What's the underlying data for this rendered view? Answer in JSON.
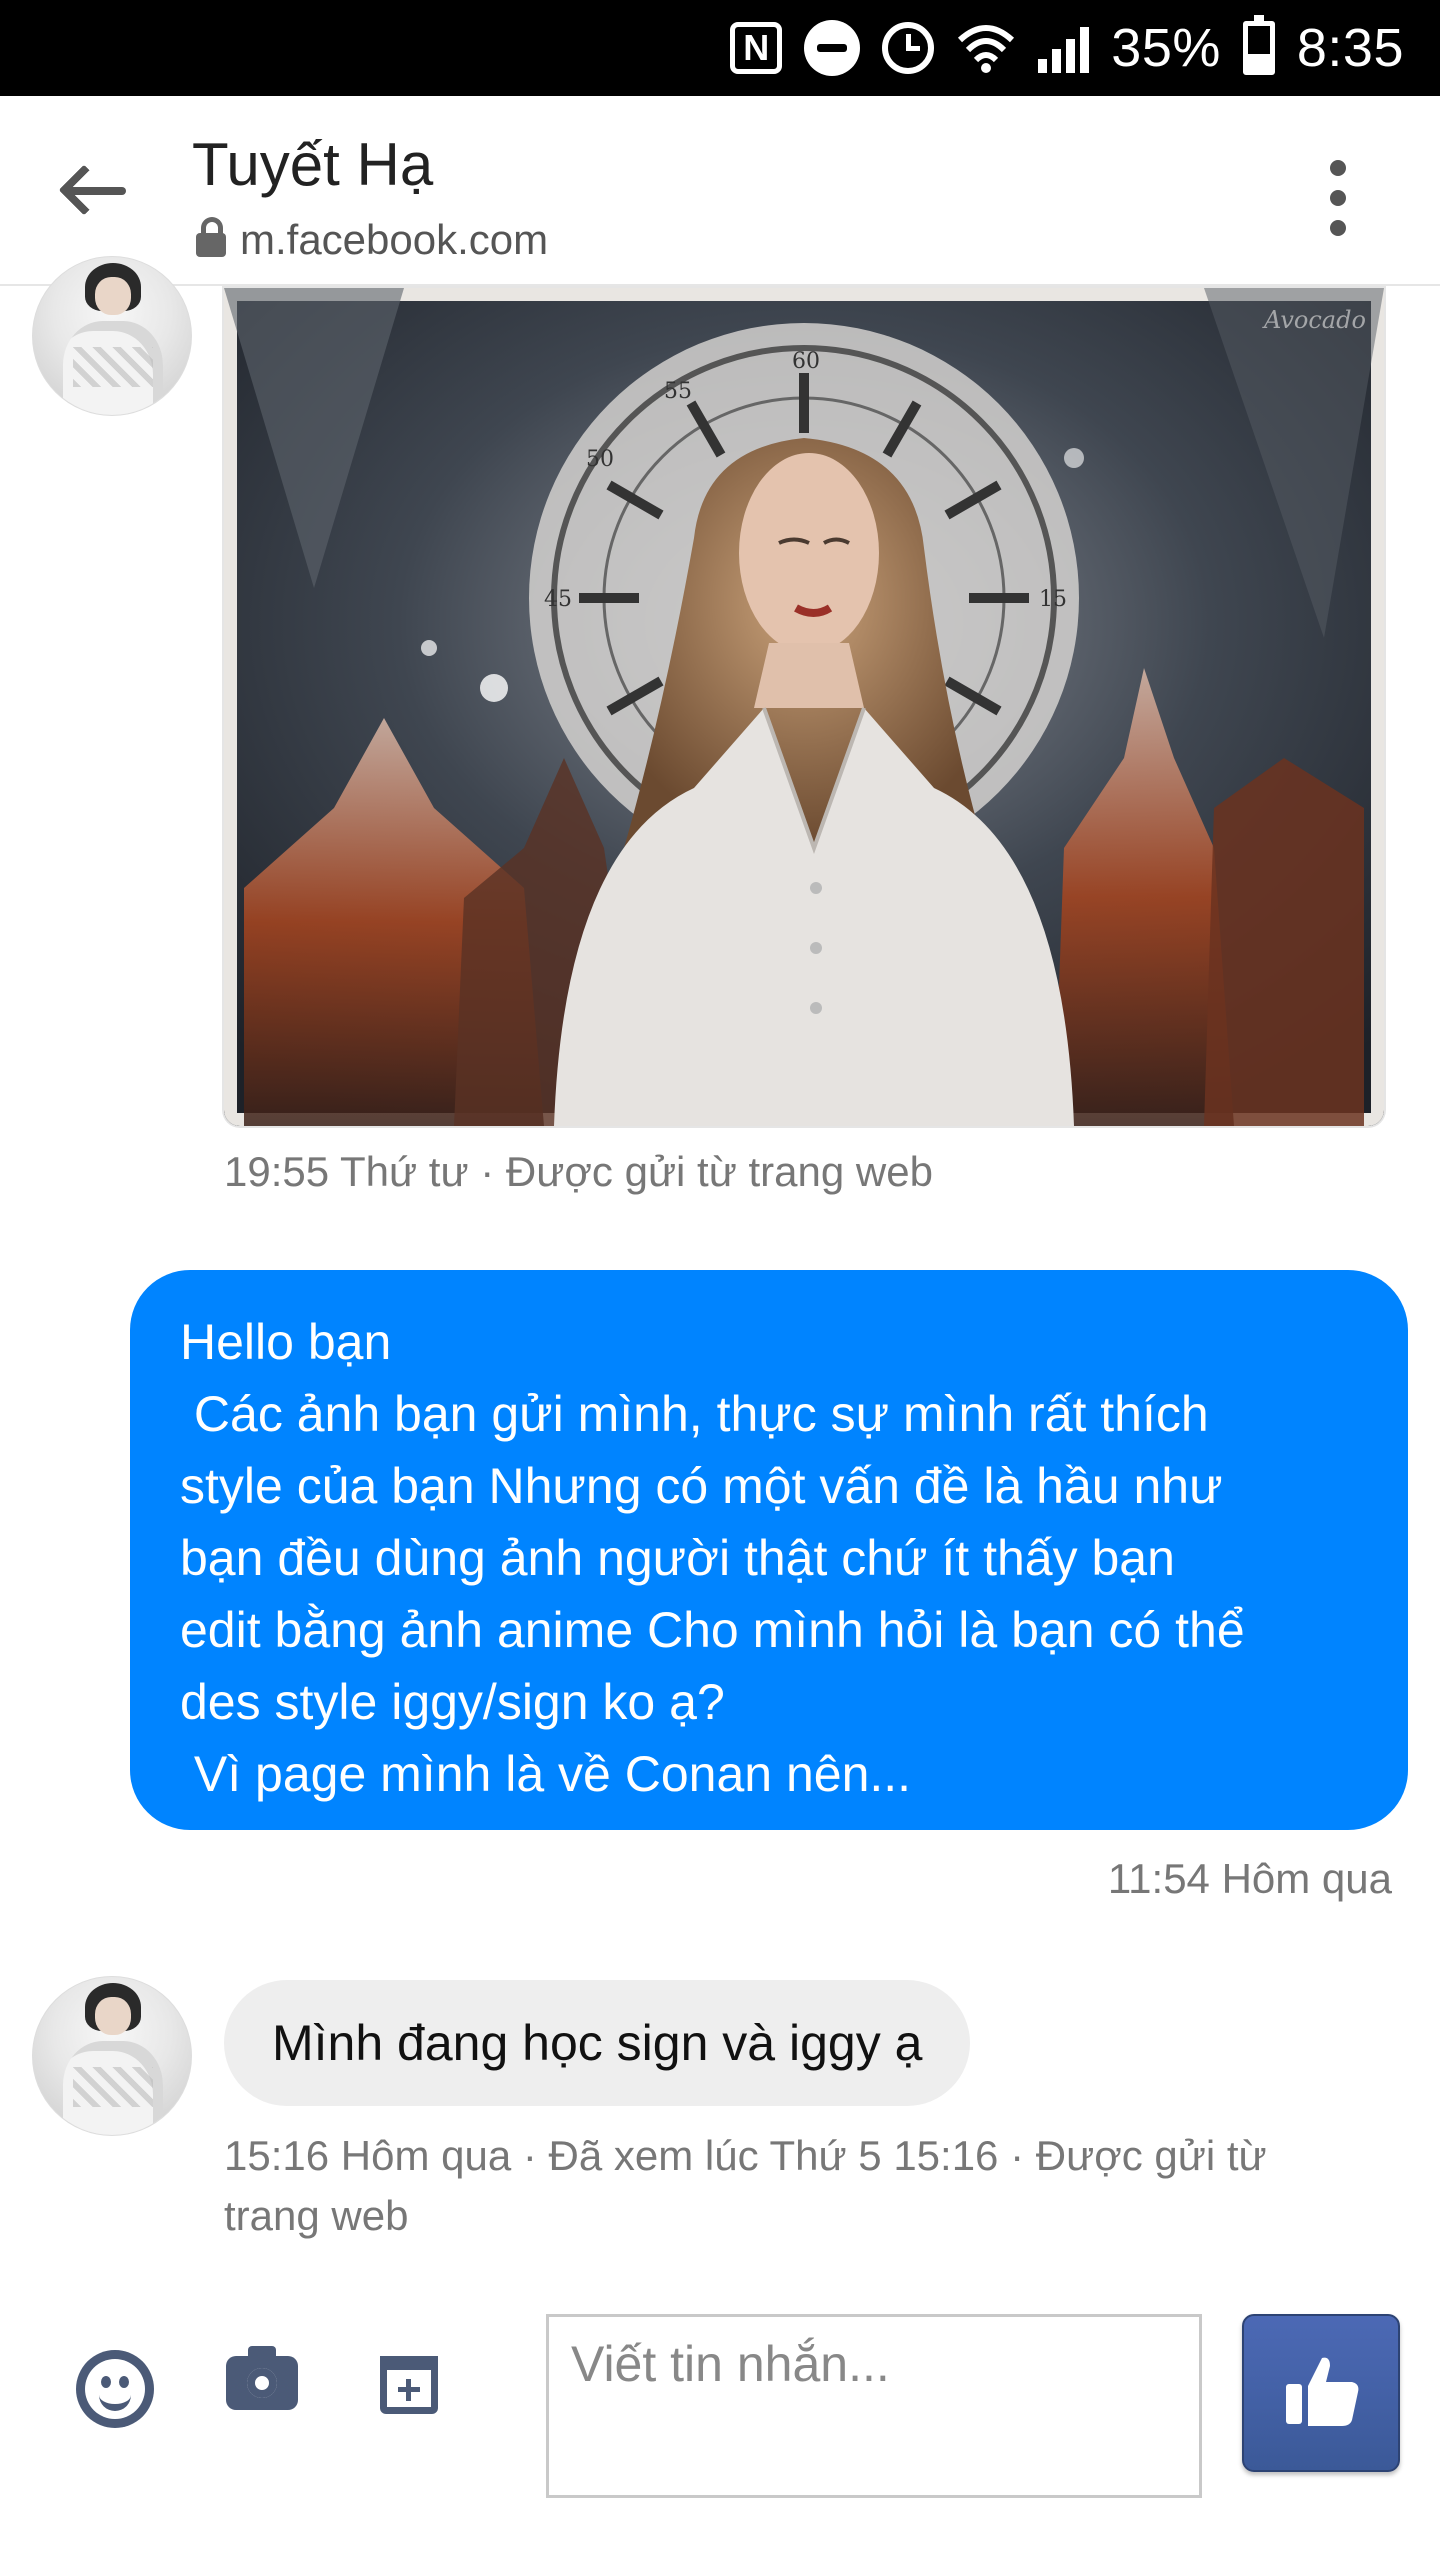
{
  "status_bar": {
    "battery": "35%",
    "time": "8:35",
    "nfc_label": "N",
    "icons": [
      "nfc-icon",
      "do-not-disturb-icon",
      "alarm-icon",
      "wifi-icon",
      "signal-icon",
      "battery-icon"
    ]
  },
  "header": {
    "title": "Tuyết Hạ",
    "url": "m.facebook.com",
    "icons": [
      "back-arrow-icon",
      "lock-icon",
      "more-vertical-icon"
    ]
  },
  "messages": [
    {
      "type": "image",
      "direction": "received",
      "watermark": "Avocado",
      "clock_numbers": [
        "60",
        "55",
        "50",
        "45",
        "15"
      ],
      "meta": "19:55 Thứ tư · Được gửi từ trang web"
    },
    {
      "type": "text",
      "direction": "sent",
      "text": "Hello bạn\n Các ảnh bạn gửi mình, thực sự mình rất thích\nstyle của bạn Nhưng có một vấn đề là hầu như\nbạn đều dùng ảnh người thật chứ ít thấy bạn\nedit bằng ảnh anime Cho mình hỏi là bạn có thể\ndes style iggy/sign ko ạ?\n Vì page mình là về Conan nên...",
      "meta": "11:54 Hôm qua"
    },
    {
      "type": "text",
      "direction": "received",
      "text": "Mình đang học sign và iggy ạ",
      "meta_line1": "15:16 Hôm qua · Đã xem lúc Thứ 5 15:16 · Được gửi từ",
      "meta_line2": "trang web"
    }
  ],
  "composer": {
    "placeholder": "Viết tin nhắn...",
    "icons": [
      "emoji-icon",
      "camera-icon",
      "add-attachment-icon",
      "like-thumb-icon"
    ],
    "colors": {
      "icon": "#4b5a77",
      "like_button": "#3b5998"
    }
  },
  "colors": {
    "sent_bubble": "#0084ff",
    "received_bubble": "#eeeeee",
    "meta_text": "#777777"
  }
}
